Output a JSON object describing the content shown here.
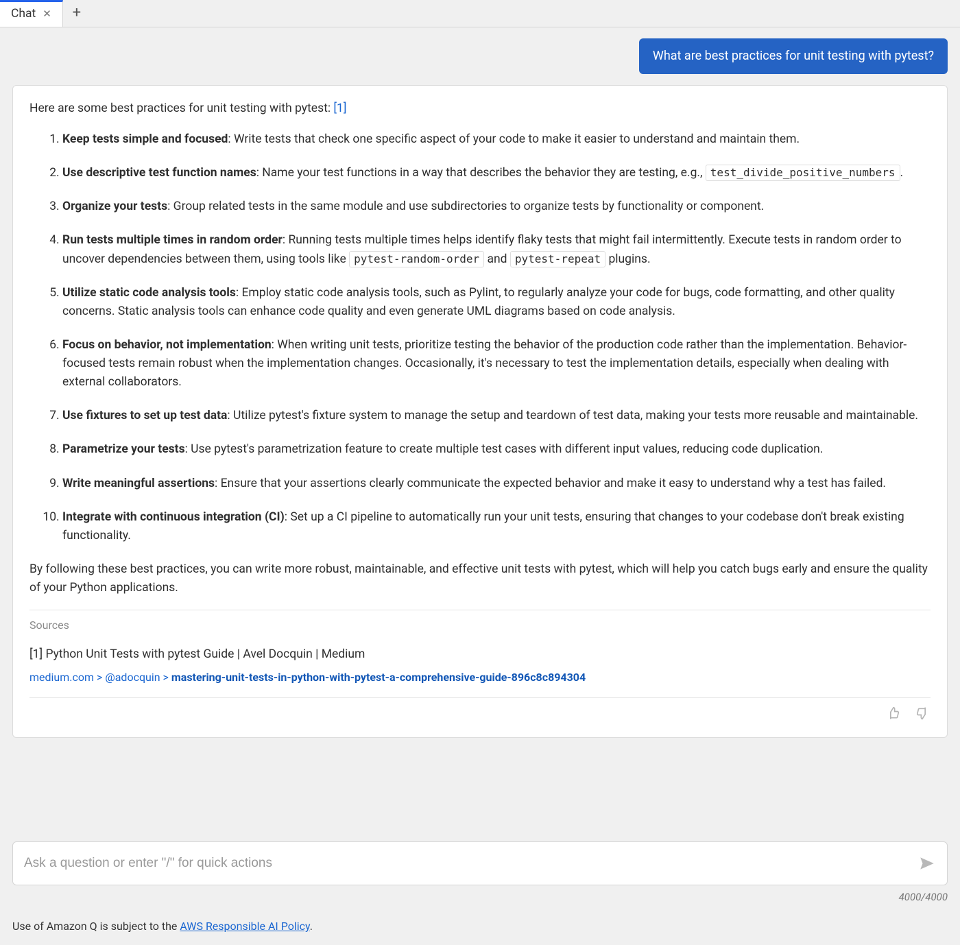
{
  "tabs": {
    "active_label": "Chat"
  },
  "user_message": "What are best practices for unit testing with pytest?",
  "assistant": {
    "intro_text": "Here are some best practices for unit testing with pytest: ",
    "citation_label": "[1]",
    "items": [
      {
        "bold": "Keep tests simple and focused",
        "text": ": Write tests that check one specific aspect of your code to make it easier to understand and maintain them."
      },
      {
        "bold": "Use descriptive test function names",
        "text": ": Name your test functions in a way that describes the behavior they are testing, e.g., ",
        "code1": "test_divide_positive_numbers",
        "tail": "."
      },
      {
        "bold": "Organize your tests",
        "text": ": Group related tests in the same module and use subdirectories to organize tests by functionality or component."
      },
      {
        "bold": "Run tests multiple times in random order",
        "text": ": Running tests multiple times helps identify flaky tests that might fail intermittently. Execute tests in random order to uncover dependencies between them, using tools like ",
        "code1": "pytest-random-order",
        "mid": " and ",
        "code2": "pytest-repeat",
        "tail": " plugins."
      },
      {
        "bold": "Utilize static code analysis tools",
        "text": ": Employ static code analysis tools, such as Pylint, to regularly analyze your code for bugs, code formatting, and other quality concerns. Static analysis tools can enhance code quality and even generate UML diagrams based on code analysis."
      },
      {
        "bold": "Focus on behavior, not implementation",
        "text": ": When writing unit tests, prioritize testing the behavior of the production code rather than the implementation. Behavior-focused tests remain robust when the implementation changes. Occasionally, it's necessary to test the implementation details, especially when dealing with external collaborators."
      },
      {
        "bold": "Use fixtures to set up test data",
        "text": ": Utilize pytest's fixture system to manage the setup and teardown of test data, making your tests more reusable and maintainable."
      },
      {
        "bold": "Parametrize your tests",
        "text": ": Use pytest's parametrization feature to create multiple test cases with different input values, reducing code duplication."
      },
      {
        "bold": "Write meaningful assertions",
        "text": ": Ensure that your assertions clearly communicate the expected behavior and make it easy to understand why a test has failed."
      },
      {
        "bold": "Integrate with continuous integration (CI)",
        "text": ": Set up a CI pipeline to automatically run your unit tests, ensuring that changes to your codebase don't break existing functionality."
      }
    ],
    "outro": "By following these best practices, you can write more robust, maintainable, and effective unit tests with pytest, which will help you catch bugs early and ensure the quality of your Python applications.",
    "sources_label": "Sources",
    "source_title": "[1] Python Unit Tests with pytest Guide | Avel Docquin | Medium",
    "breadcrumb": {
      "domain": "medium.com",
      "sep": " > ",
      "user": "@adocquin",
      "slug": "mastering-unit-tests-in-python-with-pytest-a-comprehensive-guide-896c8c894304"
    }
  },
  "input": {
    "placeholder": "Ask a question or enter \"/\" for quick actions",
    "counter": "4000/4000"
  },
  "footer": {
    "prefix": "Use of Amazon Q is subject to the ",
    "link": "AWS Responsible AI Policy",
    "suffix": "."
  }
}
